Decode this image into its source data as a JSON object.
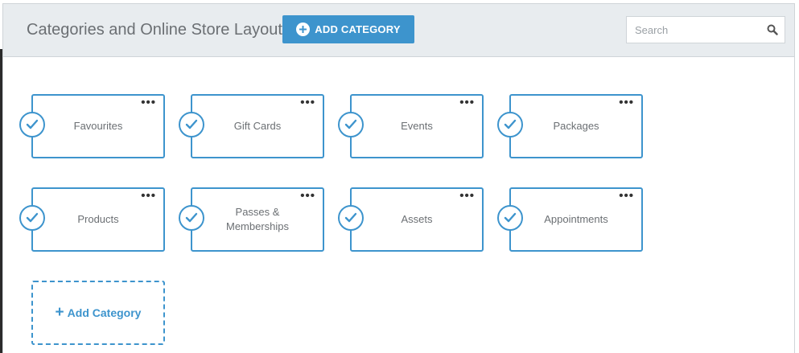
{
  "header": {
    "title": "Categories and Online Store Layout",
    "add_button_label": "ADD CATEGORY",
    "search_placeholder": "Search"
  },
  "categories": [
    {
      "label": "Favourites"
    },
    {
      "label": "Gift Cards"
    },
    {
      "label": "Events"
    },
    {
      "label": "Packages"
    },
    {
      "label": "Products"
    },
    {
      "label": "Passes &\nMemberships"
    },
    {
      "label": "Assets"
    },
    {
      "label": "Appointments"
    }
  ],
  "tile_menu_glyph": "•••",
  "add_tile": {
    "label": "Add Category"
  },
  "colors": {
    "accent": "#3d94cd",
    "header_bg": "#e8ecef",
    "text": "#6b6f73"
  }
}
